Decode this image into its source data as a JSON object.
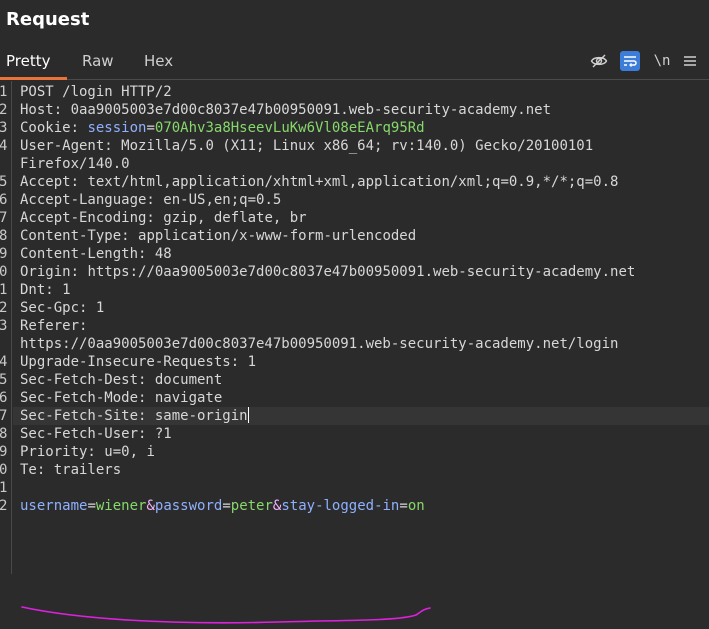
{
  "header": {
    "title": "Request"
  },
  "tabs": [
    {
      "label": "Pretty",
      "active": true
    },
    {
      "label": "Raw",
      "active": false
    },
    {
      "label": "Hex",
      "active": false
    }
  ],
  "toolbar": {
    "icons": [
      "eye-off-icon",
      "wrap-icon",
      "newline-icon",
      "menu-icon"
    ],
    "newline_label": "\\n"
  },
  "lines": [
    {
      "num": "1",
      "text": "POST /login HTTP/2"
    },
    {
      "num": "2",
      "key": "Host: ",
      "val": "0aa9005003e7d00c8037e47b00950091.web-security-academy.net"
    },
    {
      "num": "3",
      "key": "Cookie: ",
      "ckey": "session",
      "eq": "=",
      "cval": "070Ahv3a8HseevLuKw6Vl08eEArq95Rd"
    },
    {
      "num": "4",
      "key": "User-Agent: ",
      "val": "Mozilla/5.0 (X11; Linux x86_64; rv:140.0) Gecko/20100101"
    },
    {
      "num": "",
      "text": "Firefox/140.0"
    },
    {
      "num": "5",
      "key": "Accept: ",
      "val": "text/html,application/xhtml+xml,application/xml;q=0.9,*/*;q=0.8"
    },
    {
      "num": "6",
      "key": "Accept-Language: ",
      "val": "en-US,en;q=0.5"
    },
    {
      "num": "7",
      "key": "Accept-Encoding: ",
      "val": "gzip, deflate, br"
    },
    {
      "num": "8",
      "key": "Content-Type: ",
      "val": "application/x-www-form-urlencoded"
    },
    {
      "num": "9",
      "key": "Content-Length: ",
      "val": "48"
    },
    {
      "num": "0",
      "key": "Origin: ",
      "val": "https://0aa9005003e7d00c8037e47b00950091.web-security-academy.net"
    },
    {
      "num": "1",
      "key": "Dnt: ",
      "val": "1"
    },
    {
      "num": "2",
      "key": "Sec-Gpc: ",
      "val": "1"
    },
    {
      "num": "3",
      "key": "Referer: ",
      "val": ""
    },
    {
      "num": "",
      "text": "https://0aa9005003e7d00c8037e47b00950091.web-security-academy.net/login"
    },
    {
      "num": "4",
      "key": "Upgrade-Insecure-Requests: ",
      "val": "1"
    },
    {
      "num": "5",
      "key": "Sec-Fetch-Dest: ",
      "val": "document"
    },
    {
      "num": "6",
      "key": "Sec-Fetch-Mode: ",
      "val": "navigate"
    },
    {
      "num": "7",
      "key": "Sec-Fetch-Site: ",
      "val": "same-origin"
    },
    {
      "num": "8",
      "key": "Sec-Fetch-User: ",
      "val": "?1"
    },
    {
      "num": "9",
      "key": "Priority: ",
      "val": "u=0, i"
    },
    {
      "num": "0",
      "key": "Te: ",
      "val": "trailers"
    },
    {
      "num": "1",
      "text": ""
    },
    {
      "num": "2",
      "body": true
    }
  ],
  "body": {
    "k1": "username",
    "eq1": "=",
    "v1": "wiener",
    "amp1": "&",
    "k2": "password",
    "eq2": "=",
    "v2": "peter",
    "amp2": "&",
    "k3": "stay-logged-in",
    "eq3": "=",
    "v3": "on"
  },
  "annotation_color": "#e020e0",
  "accent_tab_color": "#e8743b",
  "toggle_color": "#3b7dd8"
}
